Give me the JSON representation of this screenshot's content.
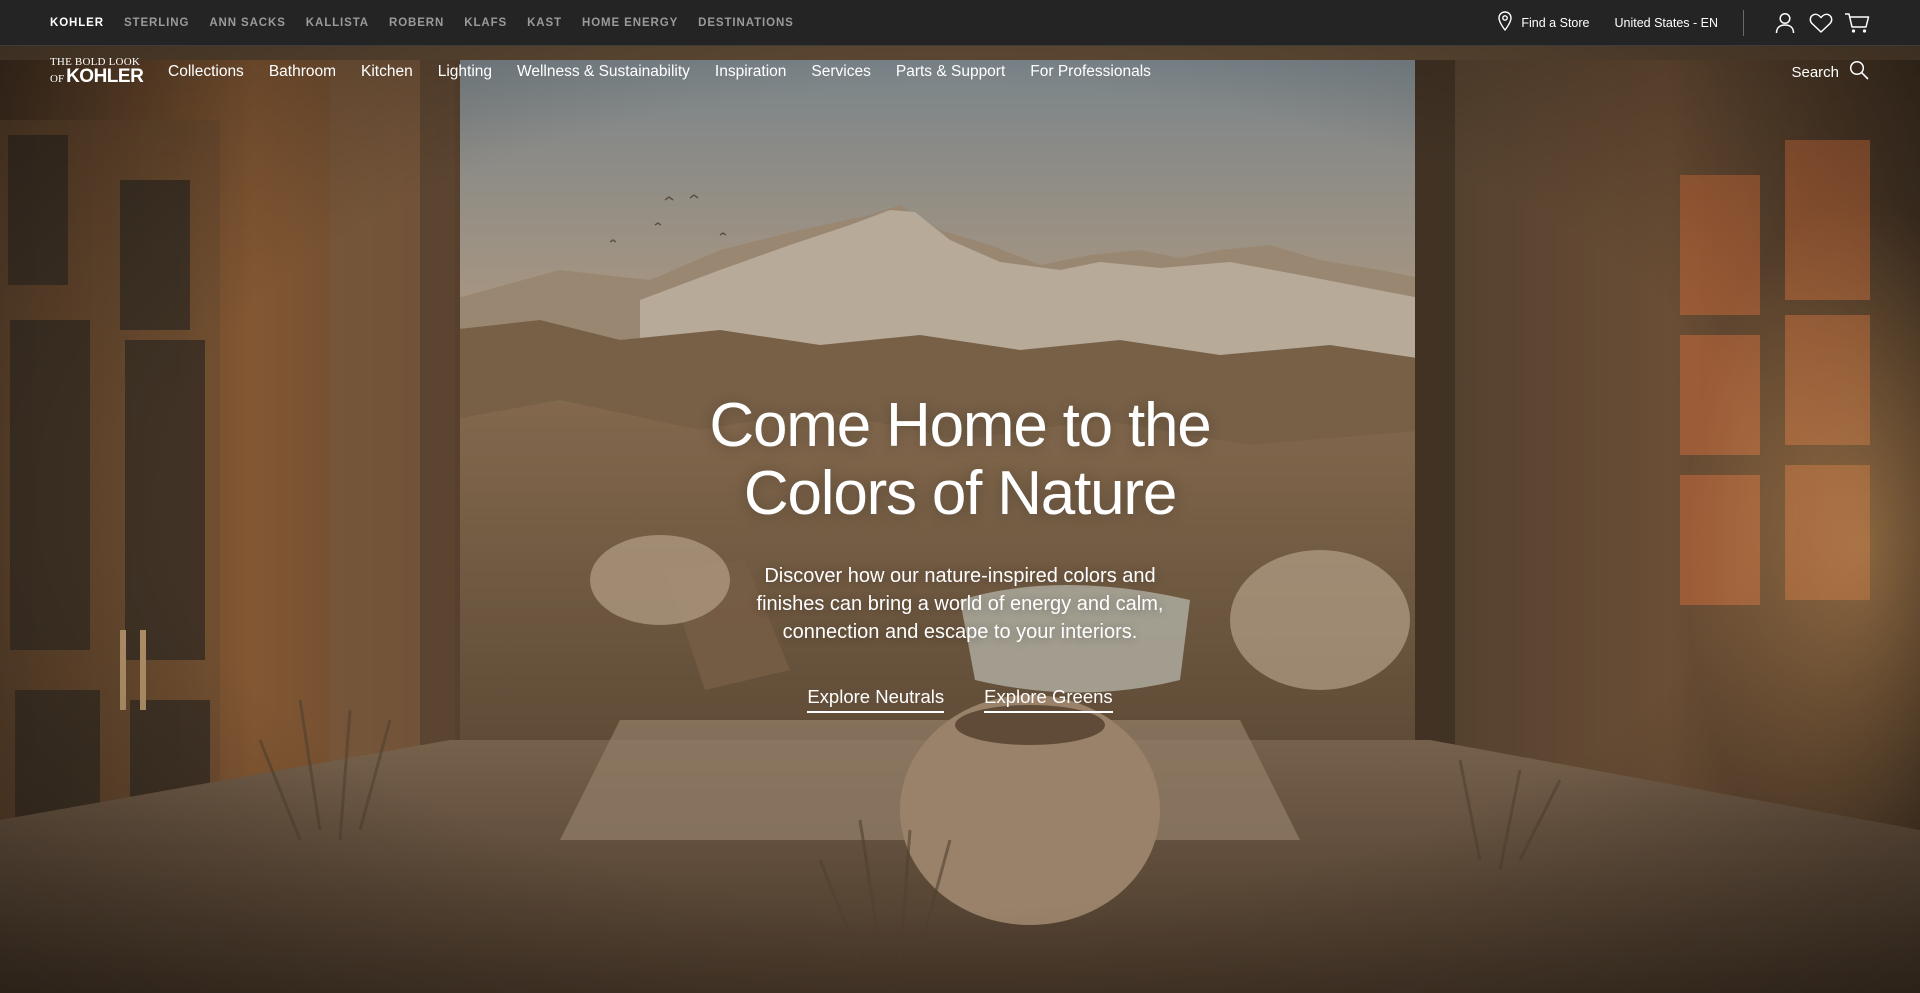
{
  "brand_bar": {
    "brands": [
      {
        "label": "KOHLER",
        "active": true
      },
      {
        "label": "STERLING",
        "active": false
      },
      {
        "label": "ANN SACKS",
        "active": false
      },
      {
        "label": "KALLISTA",
        "active": false
      },
      {
        "label": "ROBERN",
        "active": false
      },
      {
        "label": "KLAFS",
        "active": false
      },
      {
        "label": "KAST",
        "active": false
      },
      {
        "label": "HOME ENERGY",
        "active": false
      },
      {
        "label": "DESTINATIONS",
        "active": false
      }
    ],
    "find_store": "Find a Store",
    "locale": "United States - EN",
    "icons": [
      "location-pin-icon",
      "account-icon",
      "heart-icon",
      "cart-icon"
    ]
  },
  "header": {
    "logo": {
      "tagline": "THE BOLD LOOK",
      "of": "OF",
      "wordmark": "KOHLER"
    },
    "nav": [
      "Collections",
      "Bathroom",
      "Kitchen",
      "Lighting",
      "Wellness & Sustainability",
      "Inspiration",
      "Services",
      "Parts & Support",
      "For Professionals"
    ],
    "search_label": "Search"
  },
  "hero": {
    "title": "Come Home to the Colors of Nature",
    "subtitle": "Discover how our nature-inspired colors and finishes can bring a world of energy and calm, connection and escape to your interiors.",
    "ctas": [
      "Explore Neutrals",
      "Explore Greens"
    ]
  },
  "colors": {
    "brand_bar_bg": "#242424",
    "brand_active": "#ffffff",
    "brand_inactive": "#9a9a9a",
    "text_on_hero": "#ffffff"
  }
}
